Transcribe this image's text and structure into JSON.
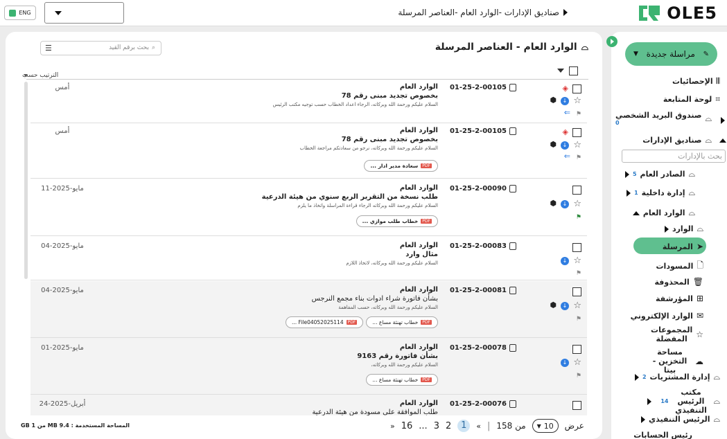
{
  "header": {
    "logo_text": "OLE5",
    "breadcrumb": "صناديق الإدارات  -الوارد العام -العناصر المرسلة",
    "lang": "ENG"
  },
  "sidebar": {
    "new_mail": "مراسلة جديدة",
    "search_placeholder": "بحث بالإدارات",
    "items": [
      {
        "label": "الإحصائيات"
      },
      {
        "label": "لوحة المتابعة"
      },
      {
        "label": "صندوق البريد الشخصي",
        "count": "0"
      },
      {
        "label": "صناديق الإدارات"
      },
      {
        "label": "الصادر العام",
        "count": "5"
      },
      {
        "label": "إدارة داخلية",
        "count": "1"
      },
      {
        "label": "الوارد العام"
      },
      {
        "label": "الوارد"
      },
      {
        "label": "المرسلة"
      },
      {
        "label": "المسودات"
      },
      {
        "label": "المحذوفة"
      },
      {
        "label": "المؤرشفة"
      },
      {
        "label": "الوارد الإلكتروني"
      },
      {
        "label": "المجموعات المفضلة"
      },
      {
        "label": "مساحة التخزين - بيتا"
      },
      {
        "label": "إدارة المشتريات",
        "count": "2"
      },
      {
        "label": "مكتب الرئيس التنفيذي",
        "count": "14"
      },
      {
        "label": "الرئيس التنفيذي"
      },
      {
        "label": "رئيس الحسابات"
      }
    ]
  },
  "main": {
    "title": "الوارد العام - العناصر المرسلة",
    "search_placeholder": "بحث برقم القيد",
    "sort_label": "الترتيب حسب",
    "rows": [
      {
        "ref": "01-25-2-00105",
        "sender": "الوارد العام",
        "subject": "بخصوص تجديد مبنى رقم 78",
        "body": "السلام عليكم ورحمة الله وبركاته، الرجاء اعداد الخطاب حسب توجيه مكتب الرئيس",
        "date": "أمس",
        "attachments": []
      },
      {
        "ref": "01-25-2-00105",
        "sender": "الوارد العام",
        "subject": "بخصوص تجديد مبنى رقم 78",
        "body": "السلام عليكم ورحمة الله وبركاته، نرجو من سعادتكم مراجعة الخطاب",
        "date": "أمس",
        "attachments": [
          "سعادة مدير ادار ..."
        ]
      },
      {
        "ref": "01-25-2-00090",
        "sender": "الوارد العام",
        "subject": "طلب نسخة من التقرير الربع سنوي من هيئة الدرعية",
        "body": "السلام عليكم ورحمة الله وبركاته الرجاء قراءة المراسلة واتخاذ ما يلزم",
        "date": "11-مايو-2025",
        "attachments": [
          "خطاب طلب موازي ..."
        ]
      },
      {
        "ref": "01-25-2-00083",
        "sender": "الوارد العام",
        "subject": "مثال وارد",
        "body": "السلام عليكم ورحمة الله وبركاته، لاتخاذ اللازم",
        "date": "04-مايو-2025",
        "attachments": []
      },
      {
        "ref": "01-25-2-00081",
        "sender": "الوارد العام",
        "subject": "بشأن فاتورة شراء ادوات بناء مجمع النرجس",
        "body": "السلام عليكم ورحمة الله وبركاته، حسب المفاهمة",
        "date": "04-مايو-2025",
        "attachments": [
          "خطاب تهنئة مساع ...",
          "File04052025114 ..."
        ]
      },
      {
        "ref": "01-25-2-00078",
        "sender": "الوارد العام",
        "subject": "بشأن فاتورة رقم 9163",
        "body": "السلام عليكم ورحمة الله وبركاته،",
        "date": "01-مايو-2025",
        "attachments": [
          "خطاب تهنئة مساع ..."
        ]
      },
      {
        "ref": "01-25-2-00076",
        "sender": "الوارد العام",
        "subject": "طلب الموافقة على مسودة من هيئة الدرعية",
        "body": "",
        "date": "24-أبريل-2025",
        "attachments": []
      }
    ]
  },
  "footer": {
    "show_label": "عرض",
    "per_page": "10",
    "of_label": "من 158",
    "pages": [
      "1",
      "2",
      "3",
      "...",
      "16"
    ],
    "prev": "«",
    "next": "»",
    "storage": "المساحة المستخدمة : 9.4 MB من 1 GB"
  },
  "colors": {
    "accent": "#5fbf8f",
    "link": "#2f7de1"
  }
}
